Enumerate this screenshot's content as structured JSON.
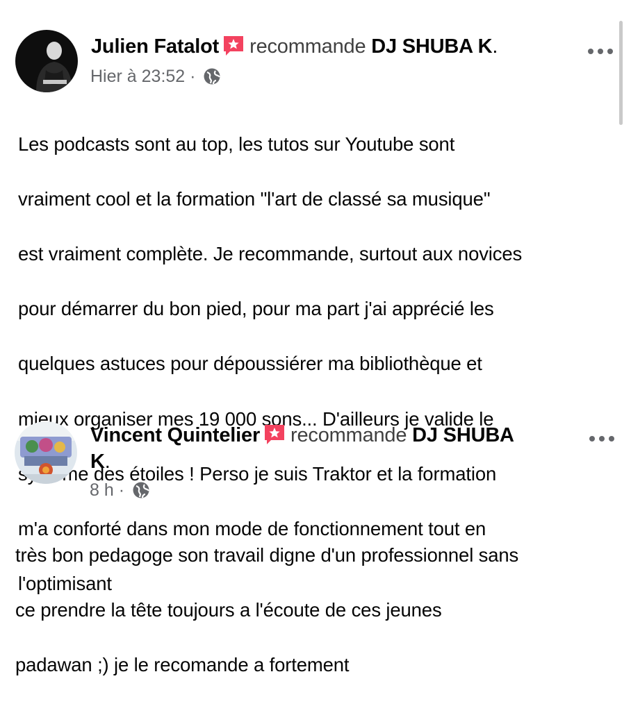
{
  "posts": [
    {
      "author": "Julien Fatalot",
      "verb": "recommande",
      "page": "DJ SHUBA K",
      "period": ".",
      "time": "Hier à 23:52",
      "separator": "·",
      "avatar_icon": "person-avatar-icon",
      "body_lines": [
        "Les podcasts sont au top, les tutos sur Youtube sont",
        "vraiment cool et la formation \"l'art de classé sa musique\"",
        "est vraiment complète. Je recommande, surtout aux novices",
        "pour démarrer du bon pied, pour ma part j'ai apprécié les",
        "quelques astuces pour dépoussiérer ma bibliothèque et",
        "mieux organiser mes 19 000 sons... D'ailleurs je valide le",
        "système des étoiles ! Perso je suis Traktor et la formation",
        "m'a conforté dans mon mode de fonctionnement tout en",
        "l'optimisant"
      ]
    },
    {
      "author": "Vincent Quintelier",
      "verb": "recommande",
      "page": "DJ SHUBA",
      "page_wrap": "K",
      "period": ".",
      "time": "8 h",
      "separator": "·",
      "avatar_icon": "graffiti-avatar-icon",
      "body_lines": [
        "très bon pedagoge son travail digne d'un professionnel sans",
        "ce prendre la tête toujours a l'écoute de ces jeunes",
        "padawan ;) je le recomande a fortement"
      ]
    }
  ],
  "icons": {
    "recommend": "recommend-star-icon",
    "privacy": "globe-icon",
    "more": "more-options-icon"
  },
  "colors": {
    "recommend_badge": "#f3425f",
    "meta_text": "#65676b",
    "body_text": "#050505"
  }
}
